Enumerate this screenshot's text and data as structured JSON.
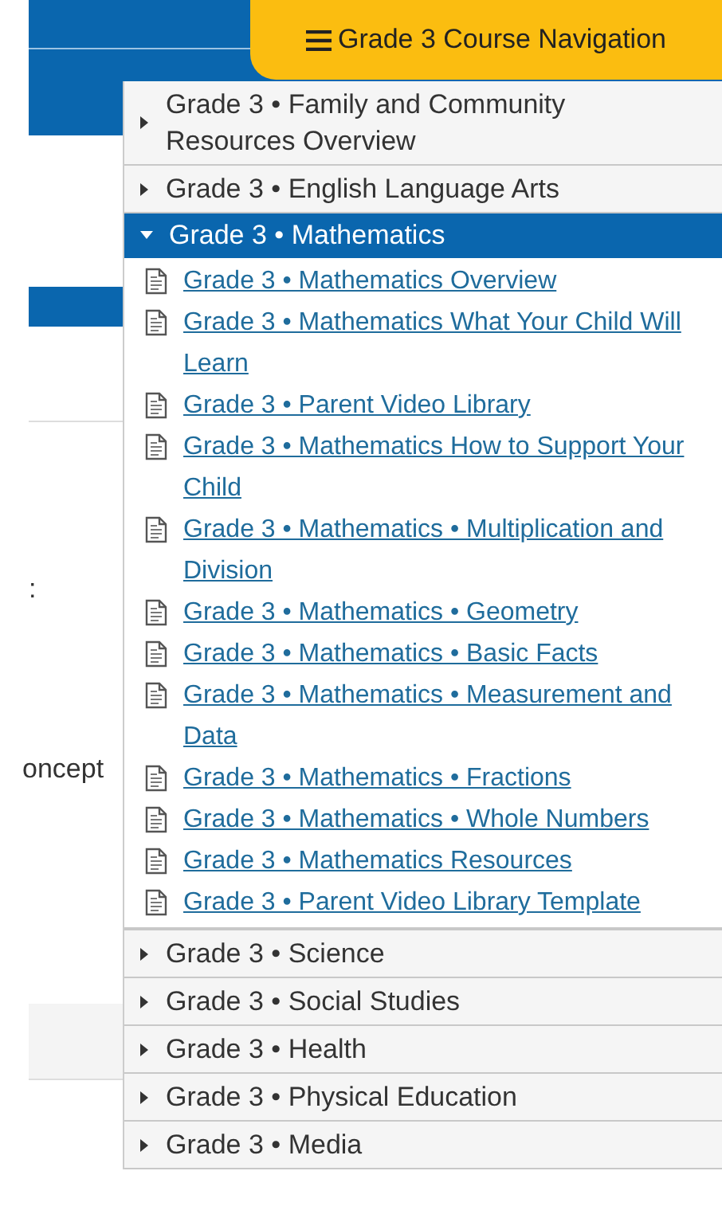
{
  "nav_button": {
    "label": "Grade 3 Course Navigation"
  },
  "background_texts": [
    ":",
    "oncept"
  ],
  "sections": [
    {
      "label": "Grade 3 • Family and Community Resources Overview",
      "expanded": false
    },
    {
      "label": "Grade 3 • English Language Arts",
      "expanded": false
    },
    {
      "label": "Grade 3 • Mathematics",
      "expanded": true,
      "children": [
        {
          "label": "Grade 3 • Mathematics Overview"
        },
        {
          "label": "Grade 3 • Mathematics What Your Child Will Learn"
        },
        {
          "label": "Grade 3 • Parent Video Library"
        },
        {
          "label": "Grade 3 • Mathematics How to Support Your Child"
        },
        {
          "label": "Grade 3 • Mathematics • Multiplication and Division"
        },
        {
          "label": "Grade 3 • Mathematics • Geometry"
        },
        {
          "label": "Grade 3 • Mathematics • Basic Facts"
        },
        {
          "label": "Grade 3 • Mathematics • Measurement and Data"
        },
        {
          "label": "Grade 3 • Mathematics • Fractions"
        },
        {
          "label": "Grade 3 • Mathematics • Whole Numbers"
        },
        {
          "label": "Grade 3 • Mathematics Resources"
        },
        {
          "label": "Grade 3 • Parent Video Library Template"
        }
      ]
    },
    {
      "label": "Grade 3 • Science",
      "expanded": false
    },
    {
      "label": "Grade 3 • Social Studies",
      "expanded": false
    },
    {
      "label": "Grade 3 • Health",
      "expanded": false
    },
    {
      "label": "Grade 3 • Physical Education",
      "expanded": false
    },
    {
      "label": "Grade 3 • Media",
      "expanded": false
    }
  ]
}
